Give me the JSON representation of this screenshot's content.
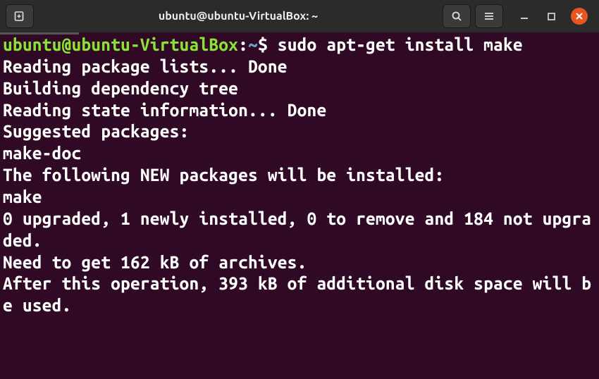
{
  "titlebar": {
    "title": "ubuntu@ubuntu-VirtualBox: ~"
  },
  "prompt": {
    "user_host": "ubuntu@ubuntu-VirtualBox",
    "separator": ":",
    "path": "~",
    "symbol": "$",
    "command": "sudo apt-get install make"
  },
  "output_lines": [
    "Reading package lists... Done",
    "Building dependency tree",
    "Reading state information... Done",
    "Suggested packages:",
    "  make-doc",
    "The following NEW packages will be installed:",
    "  make",
    "0 upgraded, 1 newly installed, 0 to remove and 184 not upgraded.",
    "Need to get 162 kB of archives.",
    "After this operation, 393 kB of additional disk space will be used."
  ]
}
